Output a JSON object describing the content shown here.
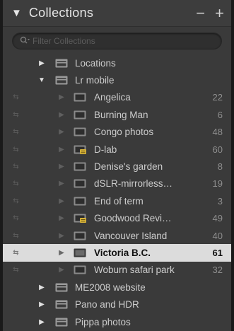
{
  "panel": {
    "title": "Collections",
    "add_label": "+",
    "collapse_label": "−",
    "expanded_glyph": "▼",
    "filter_placeholder": "Filter Collections",
    "filter_icon": "search-icon"
  },
  "glyphs": {
    "collapsed": "▶",
    "expanded": "▼",
    "sync": "⇆"
  },
  "top_sets": [
    {
      "label": "Locations",
      "expanded": false
    },
    {
      "label": "Lr mobile",
      "expanded": true
    }
  ],
  "mobile_collections": [
    {
      "label": "Angelica",
      "count": "22",
      "smart": false
    },
    {
      "label": "Burning Man",
      "count": "6",
      "smart": false
    },
    {
      "label": "Congo photos",
      "count": "48",
      "smart": false
    },
    {
      "label": "D-lab",
      "count": "60",
      "smart": true
    },
    {
      "label": "Denise's garden",
      "count": "8",
      "smart": false
    },
    {
      "label": "dSLR-mirrorless…",
      "count": "19",
      "smart": false
    },
    {
      "label": "End of term",
      "count": "3",
      "smart": false
    },
    {
      "label": "Goodwood Revi…",
      "count": "49",
      "smart": true
    },
    {
      "label": "Vancouver Island",
      "count": "40",
      "smart": false
    },
    {
      "label": "Victoria B.C.",
      "count": "61",
      "smart": false,
      "selected": true
    },
    {
      "label": "Woburn safari park",
      "count": "32",
      "smart": false
    }
  ],
  "bottom_sets": [
    {
      "label": "ME2008 website"
    },
    {
      "label": "Pano and HDR"
    },
    {
      "label": "Pippa photos"
    }
  ],
  "colors": {
    "panel_bg": "#3a3a3a",
    "selected_bg": "#dcdcdc",
    "text": "#cccccc",
    "count": "#8e8e8e",
    "smart_badge": "#d8b43a"
  }
}
